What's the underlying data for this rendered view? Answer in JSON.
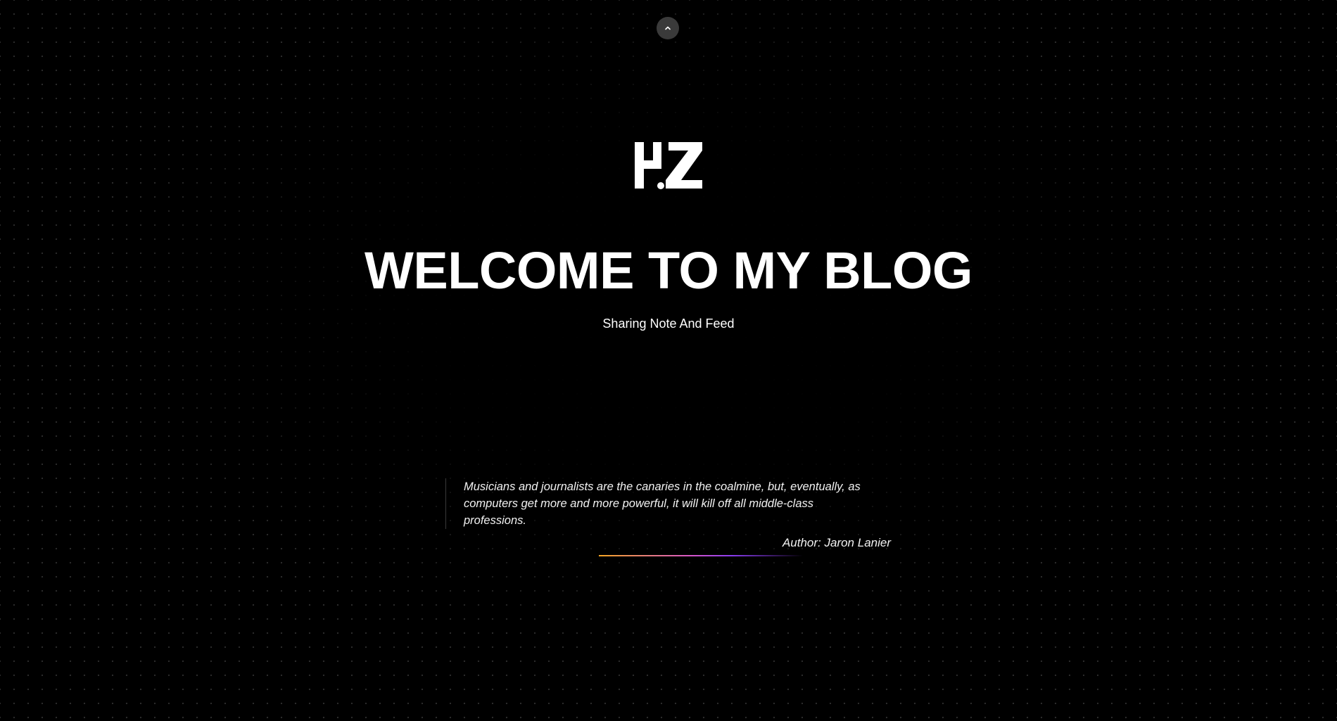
{
  "logo": {
    "text": "HZ",
    "icon": "hz-logo"
  },
  "scroll_top": {
    "icon": "chevron-up-icon"
  },
  "hero": {
    "title": "WELCOME TO MY BLOG",
    "subtitle": "Sharing Note And Feed"
  },
  "quote": {
    "text": "Musicians and journalists are the canaries in the coalmine, but, eventually, as computers get more and more powerful, it will kill off all middle-class professions.",
    "author": "Author: Jaron Lanier"
  },
  "colors": {
    "background": "#000000",
    "text": "#ffffff",
    "accent_gradient_start": "#f5a623",
    "accent_gradient_mid": "#d857c8",
    "accent_gradient_end": "#8a3cf0"
  }
}
